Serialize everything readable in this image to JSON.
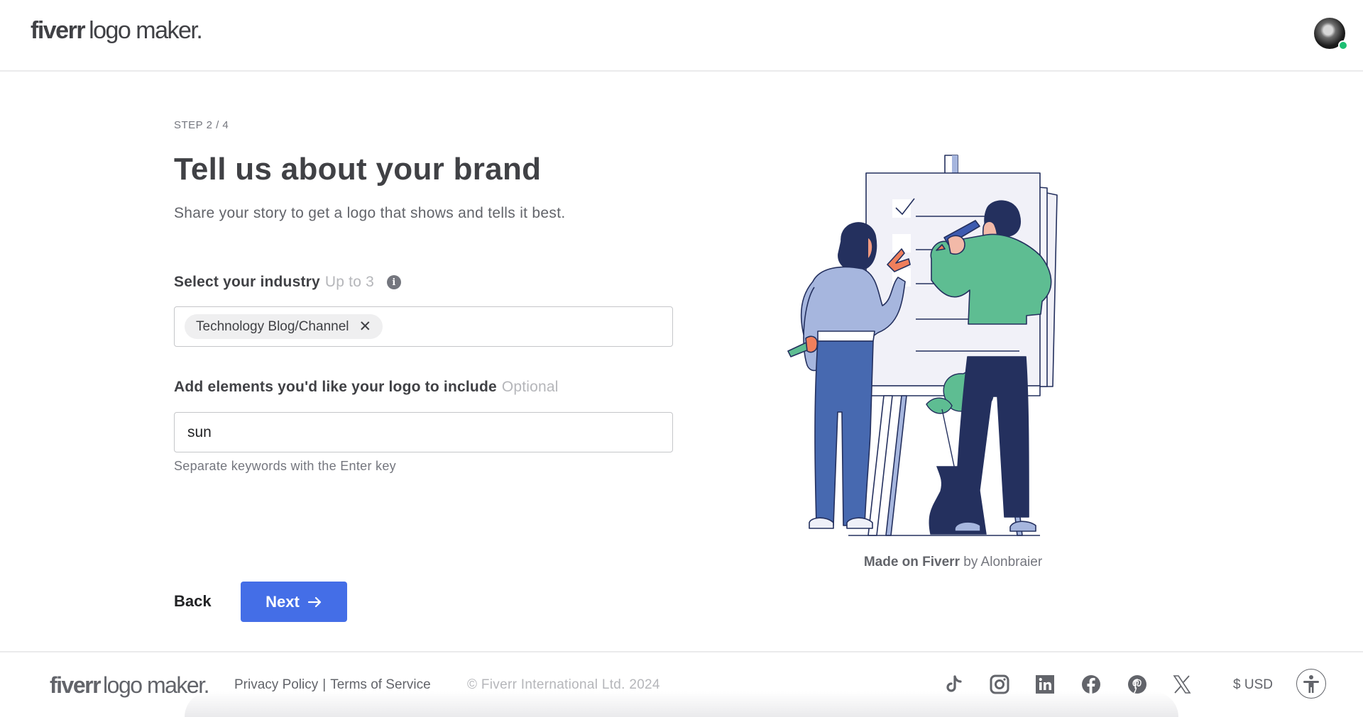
{
  "header": {
    "logo_brand": "fiverr",
    "logo_rest": "logo maker.",
    "avatar_status": "online",
    "status_color": "#1dbf73"
  },
  "main": {
    "step": "STEP 2 / 4",
    "title": "Tell us about your brand",
    "subtitle": "Share your story to get a logo that shows and tells it best.",
    "industry": {
      "label": "Select your industry",
      "qualifier": "Up to 3",
      "info_icon": "info-icon",
      "selected": [
        {
          "label": "Technology Blog/Channel",
          "remove_icon": "close-icon"
        }
      ]
    },
    "elements": {
      "label": "Add elements you'd like your logo to include",
      "qualifier": "Optional",
      "value": "sun",
      "hint": "Separate keywords with the Enter key"
    },
    "back_label": "Back",
    "next_label": "Next",
    "next_icon": "arrow-right-icon",
    "accent_color": "#446ee7"
  },
  "illustration": {
    "description": "Two people discussing a checklist on an easel board",
    "caption_strong": "Made on Fiverr",
    "caption_rest": " by Alonbraier"
  },
  "footer": {
    "logo_brand": "fiverr",
    "logo_rest": "logo maker.",
    "privacy": "Privacy Policy",
    "separator": "|",
    "terms": "Terms of Service",
    "copyright": "© Fiverr International Ltd. 2024",
    "social": [
      "tiktok-icon",
      "instagram-icon",
      "linkedin-icon",
      "facebook-icon",
      "pinterest-icon",
      "x-icon"
    ],
    "currency": "$ USD",
    "accessibility_icon": "accessibility-icon"
  }
}
